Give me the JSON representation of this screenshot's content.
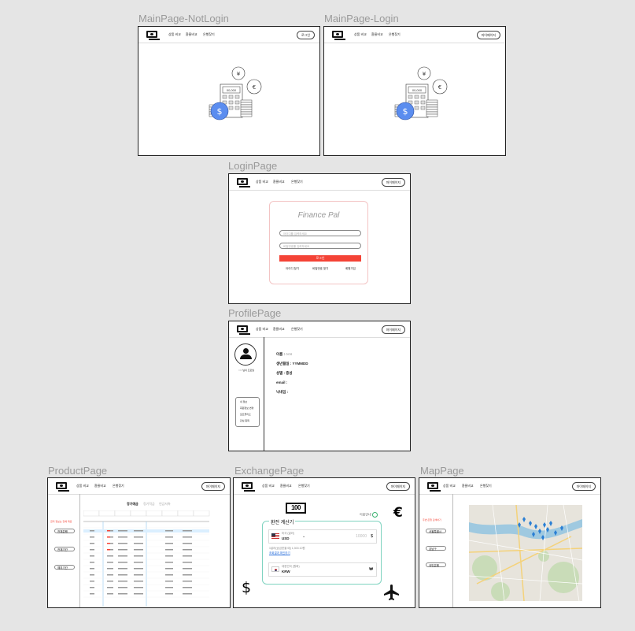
{
  "frames": {
    "main_notlogin": {
      "title": "MainPage-NotLogin",
      "header_button": "로그인"
    },
    "main_login": {
      "title": "MainPage-Login",
      "header_button": "마이페이지"
    },
    "login": {
      "title": "LoginPage",
      "header_button": "마이페이지",
      "brand": "Finance Pal",
      "id_placeholder": "아이디를 입력하세요",
      "pw_placeholder": "비밀번호를 입력하세요",
      "login_button": "로그인",
      "links": [
        "아이디 찾기",
        "비밀번호 찾기",
        "회원가입"
      ]
    },
    "profile": {
      "title": "ProfilePage",
      "header_button": "마이페이지",
      "user_caption": "○○○님의 프로필",
      "menu": [
        "내 정보",
        "회원정보 변경",
        "포트폴리오",
        "관심 종목"
      ],
      "fields": [
        "이름 : ○○○",
        "생년월일 : YYMMDD",
        "성별 : 중성",
        "email :",
        "닉네임 :"
      ]
    },
    "product": {
      "title": "ProductPage",
      "header_button": "마이페이지",
      "tabs": [
        "정기예금",
        "정기적금",
        "연금저축"
      ],
      "filters": [
        "전체은행",
        "전체기간",
        "예치기간"
      ],
      "notice": "금리 정보는 전체 제공",
      "columns": [
        "공시",
        "은행",
        "상품명",
        "금리",
        "6개월",
        "12개월",
        "24개월",
        "36개월",
        "가입"
      ]
    },
    "exchange": {
      "title": "ExchangePage",
      "header_button": "마이페이지",
      "panel_title": "환전 계산기",
      "guide": "이용안내",
      "from_label": "미국 (달러)",
      "from_code": "USD",
      "from_value": "10000",
      "from_symbol": "$",
      "rate_text": "1달러(송금받을 때) 1,300.10원",
      "rate_link": "조회결과 확인하기",
      "to_label": "대한민국 (원화)",
      "to_code": "KRW",
      "to_symbol": "₩"
    },
    "map": {
      "title": "MapPage",
      "header_button": "마이페이지",
      "notice": "주변 은행 검색하기",
      "filters": [
        "서울특별시",
        "강남구",
        "국민은행"
      ]
    }
  },
  "nav": [
    "상품 비교",
    "환율비교",
    "은행찾기"
  ],
  "colors": {
    "accent_red": "#f44336",
    "coin_blue": "#5b8def",
    "teal": "#7fd3c0",
    "map_water": "#9fc9e0"
  }
}
